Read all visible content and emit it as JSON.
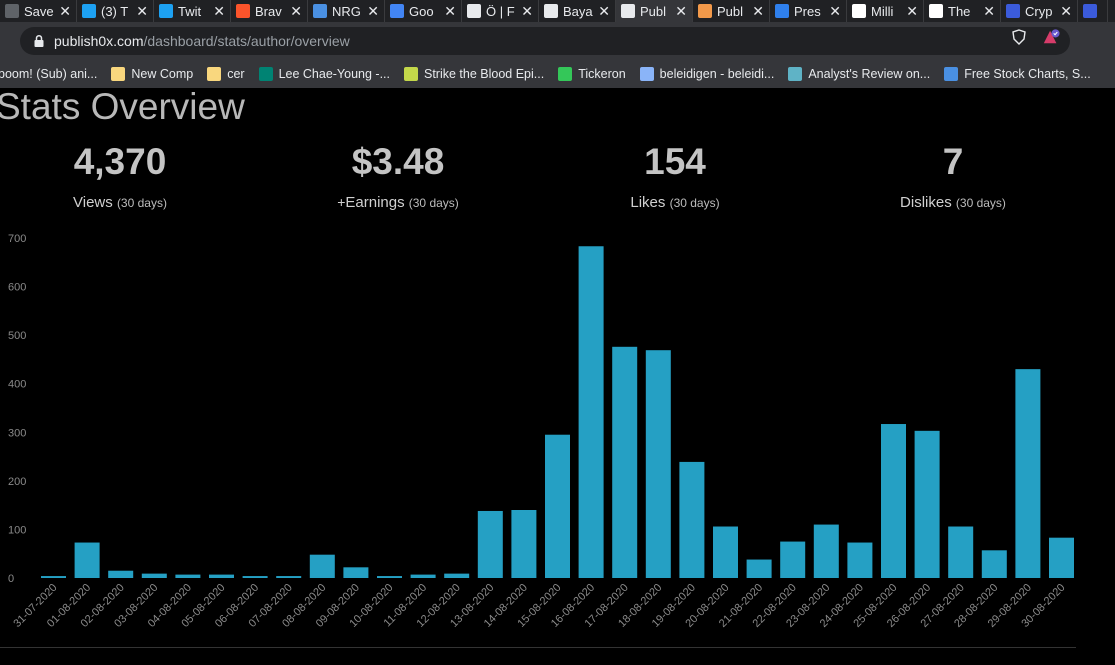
{
  "browser": {
    "tabs": [
      {
        "title": "Save",
        "icon": "save-icon",
        "color": "#5f6368"
      },
      {
        "title": "(3) T",
        "icon": "twitter-icon",
        "color": "#1da1f2"
      },
      {
        "title": "Twit",
        "icon": "twitter-icon",
        "color": "#1da1f2"
      },
      {
        "title": "Brav",
        "icon": "brave-icon",
        "color": "#fb542b"
      },
      {
        "title": "NRG",
        "icon": "chart-icon",
        "color": "#4a90e2"
      },
      {
        "title": "Goo",
        "icon": "google-translate-icon",
        "color": "#4285f4"
      },
      {
        "title": "Ö | F",
        "icon": "drop-icon",
        "color": "#e8eaed"
      },
      {
        "title": "Baya",
        "icon": "drop-icon",
        "color": "#e8eaed"
      },
      {
        "title": "Publ",
        "icon": "drop-icon",
        "color": "#e8eaed",
        "active": true
      },
      {
        "title": "Publ",
        "icon": "fire-icon",
        "color": "#f2994a"
      },
      {
        "title": "Pres",
        "icon": "p-icon",
        "color": "#2f80ed"
      },
      {
        "title": "Milli",
        "icon": "wikipedia-icon",
        "color": "#ffffff"
      },
      {
        "title": "The",
        "icon": "f-icon",
        "color": "#ffffff"
      },
      {
        "title": "Cryp",
        "icon": "coin-icon",
        "color": "#3b5bdb"
      },
      {
        "title": "",
        "icon": "coin-icon",
        "color": "#3b5bdb"
      }
    ],
    "url_host": "publish0x.com",
    "url_path": "/dashboard/stats/author/overview",
    "bookmarks": [
      {
        "label": "boom! (Sub) ani...",
        "icon": "none",
        "color": "#35363a"
      },
      {
        "label": "New Comp",
        "icon": "folder-icon",
        "color": "#f9d77e"
      },
      {
        "label": "cer",
        "icon": "folder-icon",
        "color": "#f9d77e"
      },
      {
        "label": "Lee Chae-Young -...",
        "icon": "bing-icon",
        "color": "#008373"
      },
      {
        "label": "Strike the Blood Epi...",
        "icon": "flower-icon",
        "color": "#c4d84a"
      },
      {
        "label": "Tickeron",
        "icon": "bars-icon",
        "color": "#34c759"
      },
      {
        "label": "beleidigen - beleidi...",
        "icon": "v-icon",
        "color": "#8ab4f8"
      },
      {
        "label": "Analyst's Review on...",
        "icon": "globe-icon",
        "color": "#5fb3c6"
      },
      {
        "label": "Free Stock Charts, S...",
        "icon": "chart-icon",
        "color": "#4a90e2"
      }
    ]
  },
  "page": {
    "title": "Stats Overview",
    "stats": [
      {
        "value": "4,370",
        "label": "Views",
        "period": "(30 days)"
      },
      {
        "value": "$3.48",
        "label": "Earnings",
        "period": "(30 days)"
      },
      {
        "value": "154",
        "label": "Likes",
        "period": "(30 days)"
      },
      {
        "value": "7",
        "label": "Dislikes",
        "period": "(30 days)"
      }
    ]
  },
  "chart_data": {
    "type": "bar",
    "title": "",
    "xlabel": "",
    "ylabel": "",
    "ylim": [
      0,
      700
    ],
    "yticks": [
      0,
      100,
      200,
      300,
      400,
      500,
      600,
      700
    ],
    "grid": false,
    "bar_color": "#25a0c4",
    "categories": [
      "31-07-2020",
      "01-08-2020",
      "02-08-2020",
      "03-08-2020",
      "04-08-2020",
      "05-08-2020",
      "06-08-2020",
      "07-08-2020",
      "08-08-2020",
      "09-08-2020",
      "10-08-2020",
      "11-08-2020",
      "12-08-2020",
      "13-08-2020",
      "14-08-2020",
      "15-08-2020",
      "16-08-2020",
      "17-08-2020",
      "18-08-2020",
      "19-08-2020",
      "20-08-2020",
      "21-08-2020",
      "22-08-2020",
      "23-08-2020",
      "24-08-2020",
      "25-08-2020",
      "26-08-2020",
      "27-08-2020",
      "28-08-2020",
      "29-08-2020",
      "30-08-2020"
    ],
    "values": [
      4,
      73,
      15,
      9,
      7,
      7,
      4,
      4,
      48,
      22,
      4,
      7,
      9,
      138,
      140,
      295,
      683,
      476,
      469,
      239,
      106,
      38,
      75,
      110,
      73,
      317,
      303,
      106,
      57,
      430,
      83
    ]
  }
}
